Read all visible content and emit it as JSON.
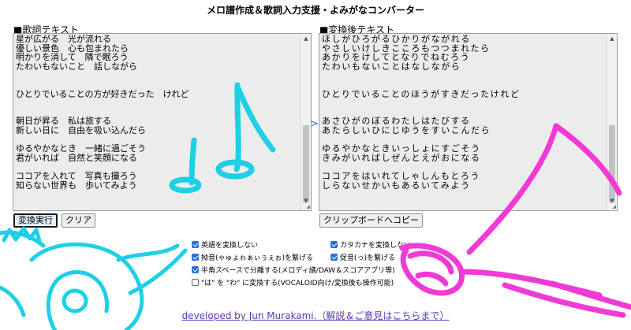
{
  "page": {
    "title": "メロ譜作成＆歌詞入力支援・よみがなコンバーター"
  },
  "input": {
    "label": "■歌詞テキスト",
    "text": "星が広がる　光が流れる\n優しい景色　心も包まれたら\n明かりを消して　隣で眠ろう\nたわいもないこと　話しながら\n\n\nひとりでいることの方が好きだった　けれど\n\n\n朝日が昇る　私は旅する\n新しい日に　自由を吸い込んだら\n\nゆるやかなとき　一緒に過ごそう\n君がいれば　自然と笑顔になる\n\nココアを入れて　写真も撮ろう\n知らない世界も　歩いてみよう"
  },
  "output": {
    "label": "■変換後テキスト",
    "text": "ほしがひろがるひかりがながれる\nやさしいけしきこころもつつまれたら\nあかりをけしてとなりでねむろう\nたわいもないことはなしながら\n\n\nひとりでいることのほうがすきだったけれど\n\n\nあさひがのぼるわたしはたびする\nあたらしいひにじゆうをすいこんだら\n\nゆるやかなときいっしょにすごそう\nきみがいればしぜんとえがおになる\n\nココアをはいれてしゃしんもとろう\nしらないせかいもあるいてみよう"
  },
  "buttons": {
    "convert": "変換実行",
    "clear": "クリア",
    "copy": "クリップボードへコピー"
  },
  "options": [
    {
      "label": "英語を変換しない",
      "checked": true
    },
    {
      "label": "カタカナを変換しない",
      "checked": true
    },
    {
      "label": "拗音(ゃゅょゎぁぃぅぇぉ)を繋げる",
      "checked": true
    },
    {
      "label": "促音(っ)を繋げる",
      "checked": true
    },
    {
      "label": "半角スペースで分離する(メロディ譜/DAW＆スコアアプリ等)",
      "checked": true
    },
    {
      "label": "\"は\" を \"わ\" に変換する(VOCALOID向け/変換後も操作可能)",
      "checked": false
    }
  ],
  "footer": {
    "link": "developed by Jun Murakami.（解説＆ご意見はこちらまで）"
  },
  "colors": {
    "doodle_cyan": "#1ed0e6",
    "doodle_magenta": "#f03ad6",
    "link": "#5b37b8",
    "checkbox": "#2d6fd8"
  }
}
